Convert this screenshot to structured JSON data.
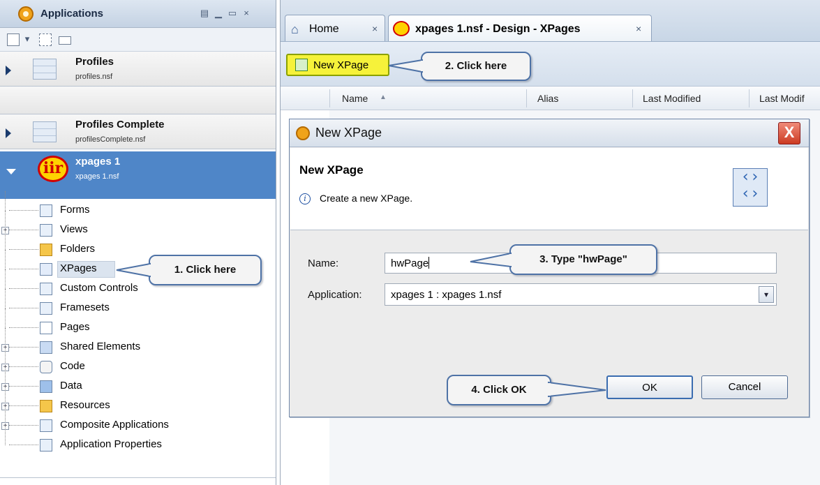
{
  "left_panel": {
    "title": "Applications",
    "apps": [
      {
        "name": "Profiles",
        "file": "profiles.nsf"
      },
      {
        "name": "Profiles Complete",
        "file": "profilesComplete.nsf"
      },
      {
        "name": "xpages 1",
        "file": "xpages 1.nsf",
        "logo": "iir"
      }
    ],
    "tree": [
      {
        "label": "Forms",
        "icon": "form-icon",
        "expandable": false
      },
      {
        "label": "Views",
        "icon": "view-icon",
        "expandable": true
      },
      {
        "label": "Folders",
        "icon": "folder-icon",
        "expandable": false
      },
      {
        "label": "XPages",
        "icon": "xpage-icon",
        "expandable": false
      },
      {
        "label": "Custom Controls",
        "icon": "custom-control-icon",
        "expandable": false
      },
      {
        "label": "Framesets",
        "icon": "frameset-icon",
        "expandable": false
      },
      {
        "label": "Pages",
        "icon": "page-icon",
        "expandable": false
      },
      {
        "label": "Shared Elements",
        "icon": "shared-elements-icon",
        "expandable": true
      },
      {
        "label": "Code",
        "icon": "code-icon",
        "expandable": true
      },
      {
        "label": "Data",
        "icon": "data-icon",
        "expandable": true
      },
      {
        "label": "Resources",
        "icon": "resources-icon",
        "expandable": true
      },
      {
        "label": "Composite Applications",
        "icon": "composite-icon",
        "expandable": true
      },
      {
        "label": "Application Properties",
        "icon": "properties-icon",
        "expandable": false
      }
    ]
  },
  "tabs": [
    {
      "label": "Home",
      "close": "×"
    },
    {
      "label": "xpages 1.nsf - Design - XPages",
      "close": "×"
    }
  ],
  "toolbar": {
    "new_xpage_label": "New XPage"
  },
  "columns": [
    "Name",
    "Alias",
    "Last Modified",
    "Last Modif"
  ],
  "dialog": {
    "window_title": "New XPage",
    "close_glyph": "X",
    "heading": "New XPage",
    "info_glyph": "i",
    "description": "Create a new XPage.",
    "name_label": "Name:",
    "name_value": "hwPage",
    "application_label": "Application:",
    "application_value": "xpages 1 : xpages 1.nsf",
    "ok_label": "OK",
    "cancel_label": "Cancel"
  },
  "callouts": {
    "step1": "1. Click here",
    "step2": "2. Click here",
    "step3": "3. Type \"hwPage\"",
    "step4": "4. Click OK"
  },
  "colors": {
    "selected_app": "#4f86c8",
    "new_xpage_button": "#f6f23a",
    "callout_border": "#4e72a6",
    "dialog_close": "#cc3b22"
  }
}
